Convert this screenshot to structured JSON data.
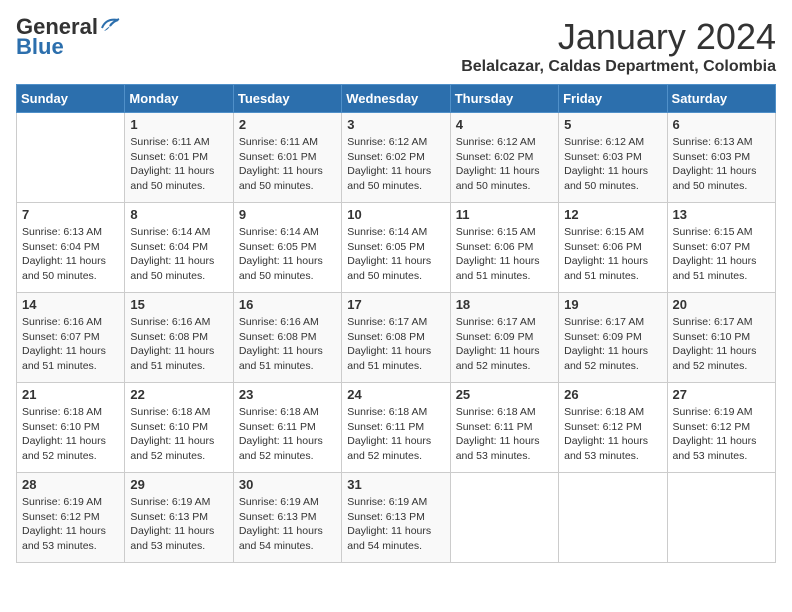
{
  "header": {
    "logo_general": "General",
    "logo_blue": "Blue",
    "month_title": "January 2024",
    "location": "Belalcazar, Caldas Department, Colombia"
  },
  "days_of_week": [
    "Sunday",
    "Monday",
    "Tuesday",
    "Wednesday",
    "Thursday",
    "Friday",
    "Saturday"
  ],
  "weeks": [
    [
      {
        "day": "",
        "info": ""
      },
      {
        "day": "1",
        "info": "Sunrise: 6:11 AM\nSunset: 6:01 PM\nDaylight: 11 hours\nand 50 minutes."
      },
      {
        "day": "2",
        "info": "Sunrise: 6:11 AM\nSunset: 6:01 PM\nDaylight: 11 hours\nand 50 minutes."
      },
      {
        "day": "3",
        "info": "Sunrise: 6:12 AM\nSunset: 6:02 PM\nDaylight: 11 hours\nand 50 minutes."
      },
      {
        "day": "4",
        "info": "Sunrise: 6:12 AM\nSunset: 6:02 PM\nDaylight: 11 hours\nand 50 minutes."
      },
      {
        "day": "5",
        "info": "Sunrise: 6:12 AM\nSunset: 6:03 PM\nDaylight: 11 hours\nand 50 minutes."
      },
      {
        "day": "6",
        "info": "Sunrise: 6:13 AM\nSunset: 6:03 PM\nDaylight: 11 hours\nand 50 minutes."
      }
    ],
    [
      {
        "day": "7",
        "info": "Sunrise: 6:13 AM\nSunset: 6:04 PM\nDaylight: 11 hours\nand 50 minutes."
      },
      {
        "day": "8",
        "info": "Sunrise: 6:14 AM\nSunset: 6:04 PM\nDaylight: 11 hours\nand 50 minutes."
      },
      {
        "day": "9",
        "info": "Sunrise: 6:14 AM\nSunset: 6:05 PM\nDaylight: 11 hours\nand 50 minutes."
      },
      {
        "day": "10",
        "info": "Sunrise: 6:14 AM\nSunset: 6:05 PM\nDaylight: 11 hours\nand 50 minutes."
      },
      {
        "day": "11",
        "info": "Sunrise: 6:15 AM\nSunset: 6:06 PM\nDaylight: 11 hours\nand 51 minutes."
      },
      {
        "day": "12",
        "info": "Sunrise: 6:15 AM\nSunset: 6:06 PM\nDaylight: 11 hours\nand 51 minutes."
      },
      {
        "day": "13",
        "info": "Sunrise: 6:15 AM\nSunset: 6:07 PM\nDaylight: 11 hours\nand 51 minutes."
      }
    ],
    [
      {
        "day": "14",
        "info": "Sunrise: 6:16 AM\nSunset: 6:07 PM\nDaylight: 11 hours\nand 51 minutes."
      },
      {
        "day": "15",
        "info": "Sunrise: 6:16 AM\nSunset: 6:08 PM\nDaylight: 11 hours\nand 51 minutes."
      },
      {
        "day": "16",
        "info": "Sunrise: 6:16 AM\nSunset: 6:08 PM\nDaylight: 11 hours\nand 51 minutes."
      },
      {
        "day": "17",
        "info": "Sunrise: 6:17 AM\nSunset: 6:08 PM\nDaylight: 11 hours\nand 51 minutes."
      },
      {
        "day": "18",
        "info": "Sunrise: 6:17 AM\nSunset: 6:09 PM\nDaylight: 11 hours\nand 52 minutes."
      },
      {
        "day": "19",
        "info": "Sunrise: 6:17 AM\nSunset: 6:09 PM\nDaylight: 11 hours\nand 52 minutes."
      },
      {
        "day": "20",
        "info": "Sunrise: 6:17 AM\nSunset: 6:10 PM\nDaylight: 11 hours\nand 52 minutes."
      }
    ],
    [
      {
        "day": "21",
        "info": "Sunrise: 6:18 AM\nSunset: 6:10 PM\nDaylight: 11 hours\nand 52 minutes."
      },
      {
        "day": "22",
        "info": "Sunrise: 6:18 AM\nSunset: 6:10 PM\nDaylight: 11 hours\nand 52 minutes."
      },
      {
        "day": "23",
        "info": "Sunrise: 6:18 AM\nSunset: 6:11 PM\nDaylight: 11 hours\nand 52 minutes."
      },
      {
        "day": "24",
        "info": "Sunrise: 6:18 AM\nSunset: 6:11 PM\nDaylight: 11 hours\nand 52 minutes."
      },
      {
        "day": "25",
        "info": "Sunrise: 6:18 AM\nSunset: 6:11 PM\nDaylight: 11 hours\nand 53 minutes."
      },
      {
        "day": "26",
        "info": "Sunrise: 6:18 AM\nSunset: 6:12 PM\nDaylight: 11 hours\nand 53 minutes."
      },
      {
        "day": "27",
        "info": "Sunrise: 6:19 AM\nSunset: 6:12 PM\nDaylight: 11 hours\nand 53 minutes."
      }
    ],
    [
      {
        "day": "28",
        "info": "Sunrise: 6:19 AM\nSunset: 6:12 PM\nDaylight: 11 hours\nand 53 minutes."
      },
      {
        "day": "29",
        "info": "Sunrise: 6:19 AM\nSunset: 6:13 PM\nDaylight: 11 hours\nand 53 minutes."
      },
      {
        "day": "30",
        "info": "Sunrise: 6:19 AM\nSunset: 6:13 PM\nDaylight: 11 hours\nand 54 minutes."
      },
      {
        "day": "31",
        "info": "Sunrise: 6:19 AM\nSunset: 6:13 PM\nDaylight: 11 hours\nand 54 minutes."
      },
      {
        "day": "",
        "info": ""
      },
      {
        "day": "",
        "info": ""
      },
      {
        "day": "",
        "info": ""
      }
    ]
  ]
}
